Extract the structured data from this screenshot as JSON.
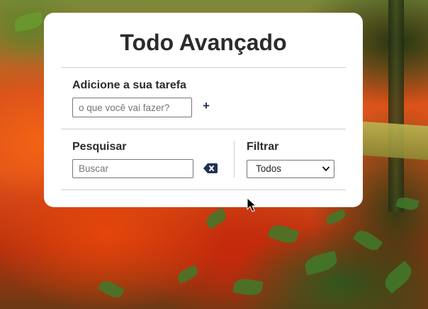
{
  "app": {
    "title": "Todo Avançado"
  },
  "add_task": {
    "label": "Adicione a sua tarefa",
    "input_value": "",
    "placeholder": "o que você vai fazer?",
    "add_button_label": "+"
  },
  "search": {
    "label": "Pesquisar",
    "input_value": "",
    "placeholder": "Buscar",
    "clear_icon": "backspace-icon"
  },
  "filter": {
    "label": "Filtrar",
    "selected": "Todos"
  },
  "colors": {
    "accent": "#233055",
    "card_bg": "#ffffff",
    "text": "#2b2b2b",
    "divider": "#cfcfcf"
  }
}
